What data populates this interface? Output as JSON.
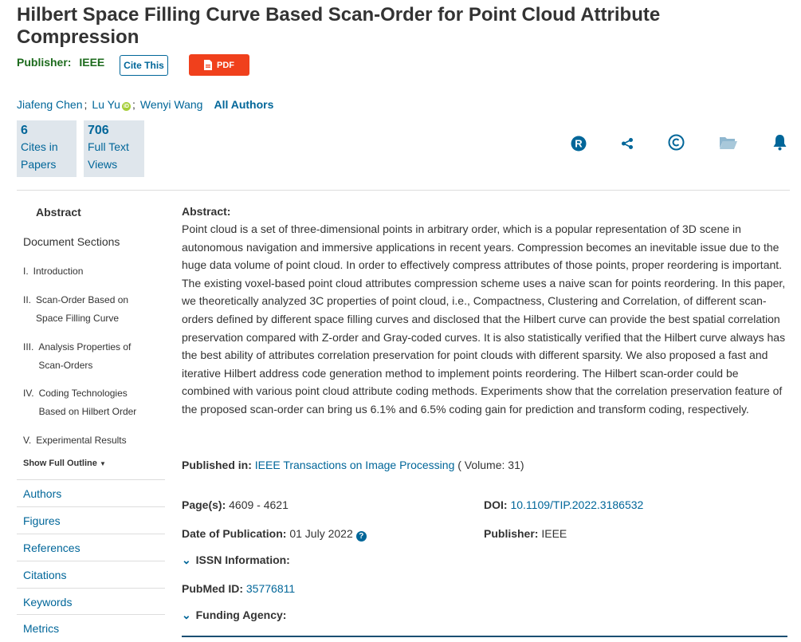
{
  "title": "Hilbert Space Filling Curve Based Scan-Order for Point Cloud Attribute Compression",
  "publisher_row": {
    "label": "Publisher:",
    "value": "IEEE"
  },
  "buttons": {
    "cite": "Cite This",
    "pdf": "PDF"
  },
  "authors": [
    "Jiafeng Chen",
    "Lu Yu",
    "Wenyi Wang"
  ],
  "author_sep": ";",
  "all_authors": "All Authors",
  "metrics": [
    {
      "num": "6",
      "label": "Cites in Papers"
    },
    {
      "num": "706",
      "label": "Full Text Views"
    }
  ],
  "toolbar_icons": [
    "rights-icon",
    "share-icon",
    "copyright-icon",
    "folder-icon",
    "bell-icon"
  ],
  "sidebar": {
    "abstract": "Abstract",
    "document_sections": "Document Sections",
    "sections": [
      {
        "num": "I.",
        "title": "Introduction"
      },
      {
        "num": "II.",
        "title": "Scan-Order Based on Space Filling Curve"
      },
      {
        "num": "III.",
        "title": "Analysis Properties of Scan-Orders"
      },
      {
        "num": "IV.",
        "title": "Coding Technologies Based on Hilbert Order"
      },
      {
        "num": "V.",
        "title": "Experimental Results"
      }
    ],
    "show_outline": "Show Full Outline",
    "links": [
      "Authors",
      "Figures",
      "References",
      "Citations",
      "Keywords",
      "Metrics"
    ]
  },
  "abstract": {
    "label": "Abstract:",
    "text": "Point cloud is a set of three-dimensional points in arbitrary order, which is a popular representation of 3D scene in autonomous navigation and immersive applications in recent years. Compression becomes an inevitable issue due to the huge data volume of point cloud. In order to effectively compress attributes of those points, proper reordering is important. The existing voxel-based point cloud attributes compression scheme uses a naive scan for points reordering. In this paper, we theoretically analyzed 3C properties of point cloud, i.e., Compactness, Clustering and Correlation, of different scan-orders defined by different space filling curves and disclosed that the Hilbert curve can provide the best spatial correlation preservation compared with Z-order and Gray-coded curves. It is also statistically verified that the Hilbert curve always has the best ability of attributes correlation preservation for point clouds with different sparsity. We also proposed a fast and iterative Hilbert address code generation method to implement points reordering. The Hilbert scan-order could be combined with various point cloud attribute coding methods. Experiments show that the correlation preservation feature of the proposed scan-order can bring us 6.1% and 6.5% coding gain for prediction and transform coding, respectively."
  },
  "meta": {
    "published_in_label": "Published in:",
    "published_in": "IEEE Transactions on Image Processing",
    "volume": "( Volume: 31)",
    "pages_label": "Page(s):",
    "pages": "4609 - 4621",
    "doi_label": "DOI:",
    "doi": "10.1109/TIP.2022.3186532",
    "date_label": "Date of Publication:",
    "date": "01 July 2022",
    "publisher_label": "Publisher:",
    "publisher": "IEEE",
    "issn": "ISSN Information:",
    "pubmed_label": "PubMed ID:",
    "pubmed": "35776811",
    "funding": "Funding Agency:"
  },
  "colors": {
    "link": "#006699",
    "pdf": "#f0401c",
    "publisher": "#1d6b1d",
    "metric_bg": "#dfe6ec"
  }
}
